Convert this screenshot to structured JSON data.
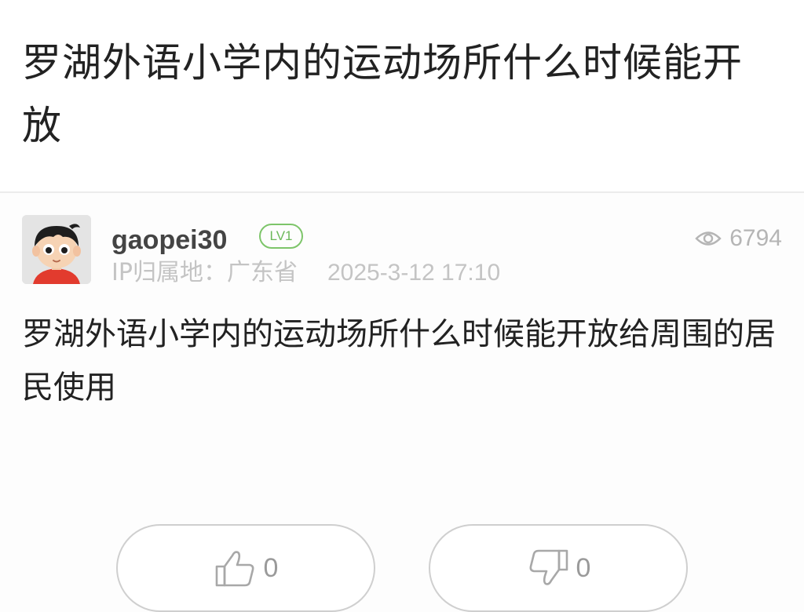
{
  "post": {
    "title": "罗湖外语小学内的运动场所什么时候能开放",
    "body": "罗湖外语小学内的运动场所什么时候能开放给周围的居民使用"
  },
  "author": {
    "username": "gaopei30",
    "level": "LV1",
    "ip_label": "IP归属地：",
    "ip_location": "广东省",
    "post_time": "2025-3-12 17:10",
    "avatar_icon": "cartoon-boy-avatar"
  },
  "stats": {
    "views": "6794",
    "view_icon": "eye-icon"
  },
  "actions": {
    "like_count": "0",
    "dislike_count": "0",
    "like_icon": "thumbs-up-icon",
    "dislike_icon": "thumbs-down-icon"
  },
  "colors": {
    "level_badge": "#7dc56a",
    "muted_text": "#c4c4c4",
    "primary_text": "#222222"
  }
}
